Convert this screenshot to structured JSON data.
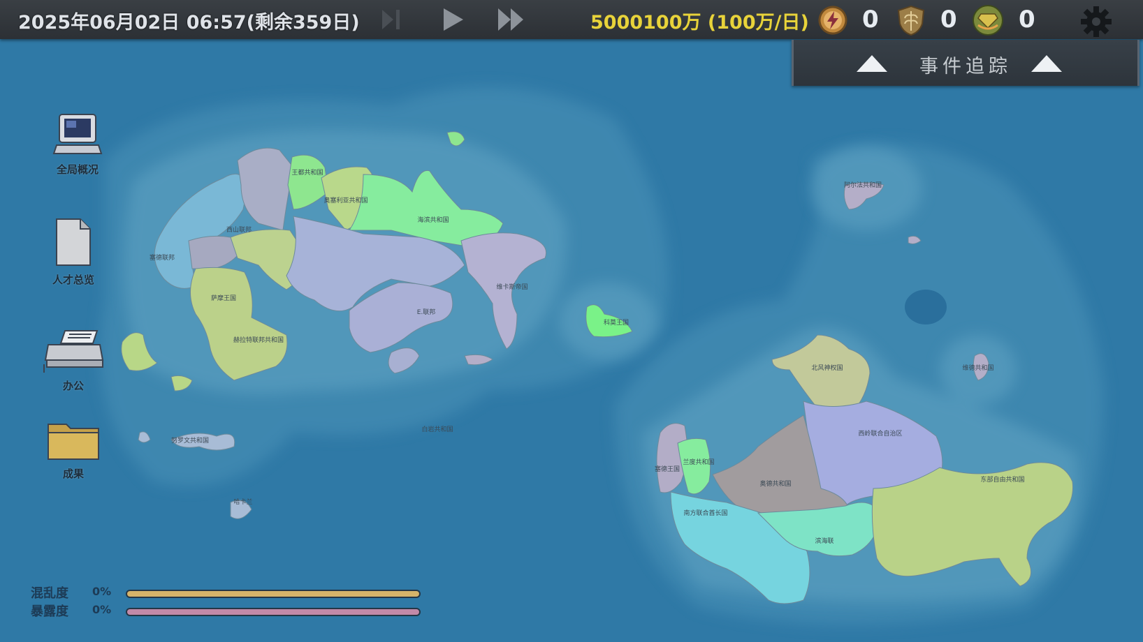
{
  "topbar": {
    "datetime": "2025年06月02日 06:57(剩余359日)",
    "money": "5000100万 (100万/日)",
    "resources": [
      {
        "name": "lightning-token-icon",
        "count": "0",
        "color": "#b97a2c"
      },
      {
        "name": "wheat-shield-icon",
        "count": "0",
        "color": "#8a6e3a"
      },
      {
        "name": "hands-gem-icon",
        "count": "0",
        "color": "#6a8b3a"
      }
    ]
  },
  "tracker": {
    "title": "事件追踪"
  },
  "desktop": [
    {
      "id": "computer",
      "label": "全局概况",
      "icon": "computer-icon"
    },
    {
      "id": "document",
      "label": "人才总览",
      "icon": "document-icon"
    },
    {
      "id": "printer",
      "label": "办公",
      "icon": "printer-icon"
    },
    {
      "id": "folder",
      "label": "成果",
      "icon": "folder-icon"
    }
  ],
  "map_labels": [
    "王都共和国",
    "奥塞利亚共和国",
    "西山联邦",
    "塞德联邦",
    "海滨共和国",
    "萨摩王国",
    "赫拉特联邦共和国",
    "维卡斯帝国",
    "E.联邦",
    "科莫王国",
    "阿尔法共和国",
    "白岩共和国",
    "努罗文共和国",
    "哈卡兰",
    "北风神权国",
    "维德共和国",
    "西岭联合自治区",
    "兰度共和国",
    "塞德王国",
    "奥德共和国",
    "南方联合酋长国",
    "滨海联",
    "东部自由共和国"
  ],
  "status": {
    "chaos": {
      "label": "混乱度",
      "pct_label": "0%",
      "value": 0,
      "color": "#d6b46a"
    },
    "riot": {
      "label": "暴露度",
      "pct_label": "0%",
      "value": 0,
      "color": "#c38aa8"
    }
  },
  "colors": {
    "sea": "#2f7ba8",
    "shallow": "#5fa4c3",
    "accent_money": "#e8d33a"
  }
}
